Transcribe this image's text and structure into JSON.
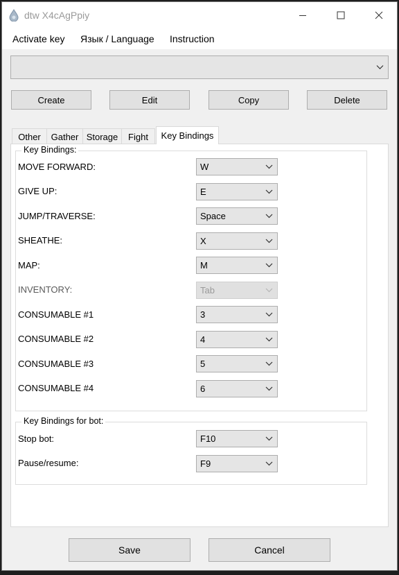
{
  "window": {
    "title": "dtw X4cAgPpiy"
  },
  "menu": {
    "items": [
      "Activate key",
      "Язык / Language",
      "Instruction"
    ]
  },
  "profile_select": {
    "value": ""
  },
  "toolbar": {
    "create": "Create",
    "edit": "Edit",
    "copy": "Copy",
    "delete": "Delete"
  },
  "tabs": [
    "Other",
    "Gather",
    "Storage",
    "Fight",
    "Key Bindings"
  ],
  "active_tab": "Key Bindings",
  "key_bindings": {
    "group_title": "Key Bindings:",
    "rows": [
      {
        "label": "MOVE FORWARD:",
        "value": "W"
      },
      {
        "label": "GIVE UP:",
        "value": "E"
      },
      {
        "label": "JUMP/TRAVERSE:",
        "value": "Space"
      },
      {
        "label": "SHEATHE:",
        "value": "X"
      },
      {
        "label": "MAP:",
        "value": "M"
      },
      {
        "label": "INVENTORY:",
        "value": "Tab"
      },
      {
        "label": "CONSUMABLE #1",
        "value": "3"
      },
      {
        "label": "CONSUMABLE #2",
        "value": "4"
      },
      {
        "label": "CONSUMABLE #3",
        "value": "5"
      },
      {
        "label": "CONSUMABLE #4",
        "value": "6"
      }
    ]
  },
  "bot_bindings": {
    "group_title": "Key Bindings for bot:",
    "rows": [
      {
        "label": "Stop bot:",
        "value": "F10"
      },
      {
        "label": "Pause/resume:",
        "value": "F9"
      }
    ]
  },
  "footer": {
    "save": "Save",
    "cancel": "Cancel"
  },
  "colors": {
    "window_bg": "#f0f0f0",
    "panel_bg": "#ffffff",
    "button_bg": "#e1e1e1",
    "disabled_text": "#9a9a9a"
  },
  "icons": [
    "app-droplet-icon",
    "minimize-icon",
    "maximize-icon",
    "close-icon",
    "chevron-down-icon"
  ]
}
